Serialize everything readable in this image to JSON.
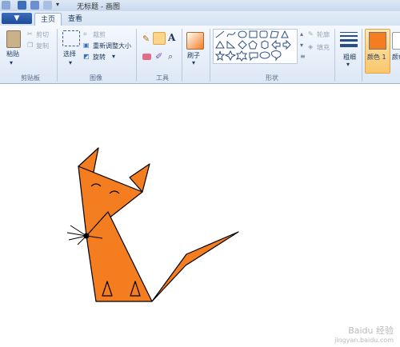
{
  "titlebar": {
    "title": "无标题 - 画图"
  },
  "tabs": {
    "menu_label": "▼",
    "home": "主页",
    "view": "查看"
  },
  "clipboard": {
    "paste": "粘贴",
    "cut": "剪切",
    "copy": "复制",
    "group": "剪贴板"
  },
  "image": {
    "select": "选择",
    "crop": "裁剪",
    "resize": "重新调整大小",
    "rotate": "旋转",
    "group": "图像"
  },
  "tools": {
    "group": "工具",
    "text_tool": "A"
  },
  "brushes": {
    "label": "刷子"
  },
  "shapes": {
    "outline": "轮廓",
    "fill": "填充",
    "group": "形状"
  },
  "size": {
    "label": "粗细"
  },
  "color": {
    "label": "颜色 1",
    "label2": "颜色"
  },
  "watermark": {
    "line1": "Baidu 经验",
    "line2": "jingyan.baidu.com"
  },
  "colors": {
    "accent": "#f47d20",
    "ribbon": "#dce7f5",
    "fox_fill": "#f47d20"
  }
}
